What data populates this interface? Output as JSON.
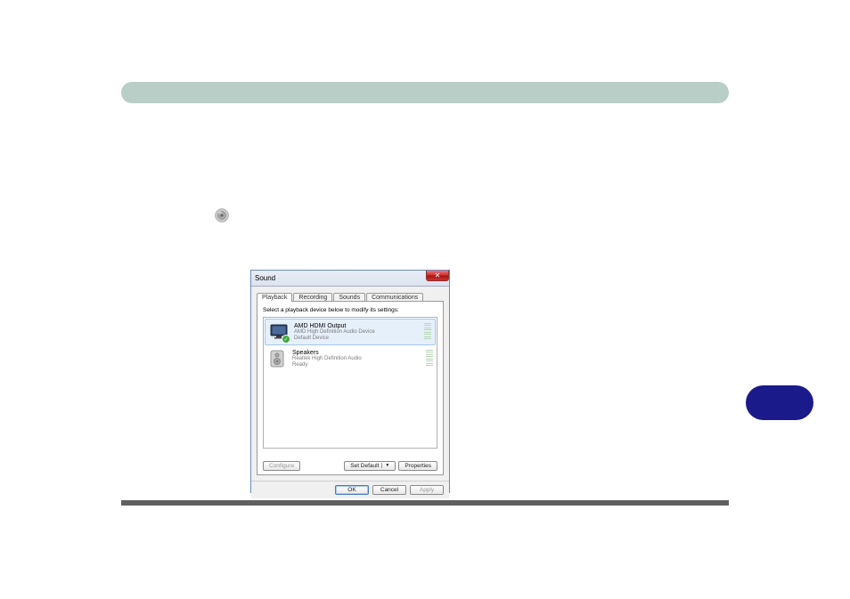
{
  "dialog": {
    "title": "Sound",
    "tabs": [
      "Playback",
      "Recording",
      "Sounds",
      "Communications"
    ],
    "active_tab_index": 0,
    "instruction": "Select a playback device below to modify its settings:",
    "devices": [
      {
        "name": "AMD HDMI Output",
        "desc": "AMD High Definition Audio Device",
        "status": "Default Device",
        "default": true,
        "selected": true,
        "icon": "monitor"
      },
      {
        "name": "Speakers",
        "desc": "Realtek High Definition Audio",
        "status": "Ready",
        "default": false,
        "selected": false,
        "icon": "speaker"
      }
    ],
    "buttons": {
      "configure": "Configure",
      "set_default": "Set Default",
      "properties": "Properties",
      "ok": "OK",
      "cancel": "Cancel",
      "apply": "Apply"
    }
  }
}
